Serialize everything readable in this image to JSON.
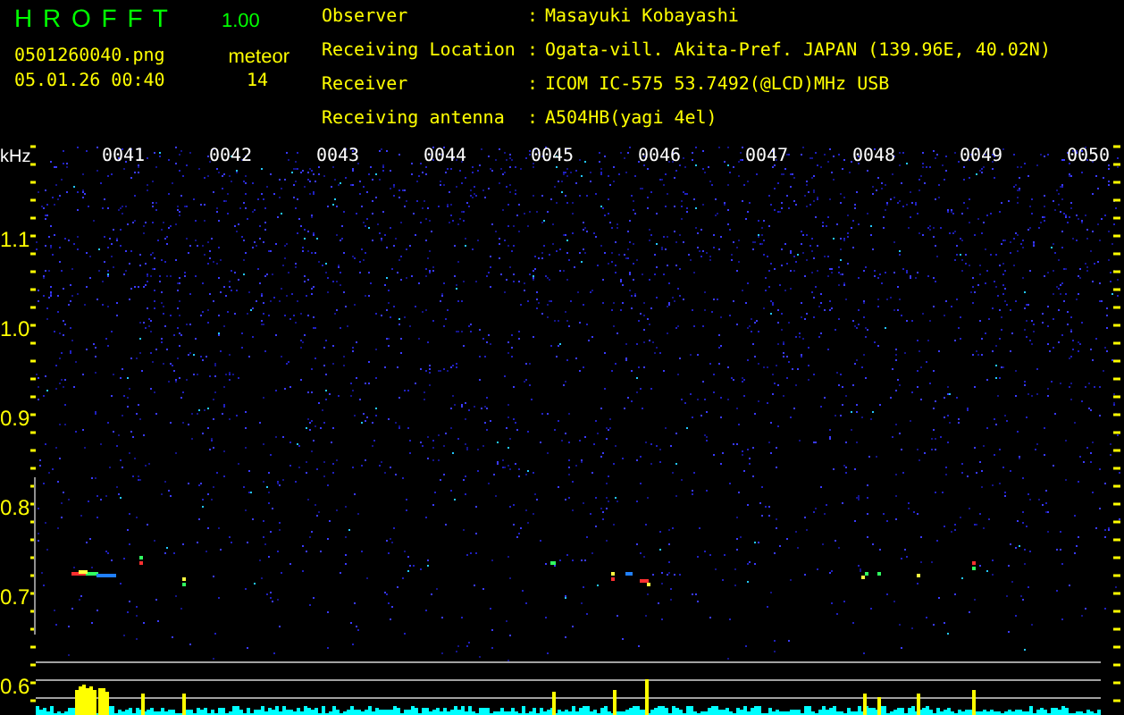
{
  "app": {
    "title": "H R O F F T",
    "version": "1.00"
  },
  "file": "0501260040.png",
  "datetime": "05.01.26 00:40",
  "meteor": {
    "label": "meteor",
    "count": "14"
  },
  "info": [
    {
      "label": "Observer",
      "sep": ":",
      "value": "Masayuki Kobayashi"
    },
    {
      "label": "Receiving Location",
      "sep": ":",
      "value": "Ogata-vill. Akita-Pref. JAPAN (139.96E, 40.02N)"
    },
    {
      "label": "Receiver",
      "sep": ":",
      "value": "ICOM IC-575 53.7492(@LCD)MHz USB"
    },
    {
      "label": "Receiving antenna",
      "sep": ":",
      "value": "A504HB(yagi 4el)"
    }
  ],
  "plot": {
    "y_unit": "kHz",
    "y_labels": [
      "1.1",
      "1.0",
      "0.9",
      "0.8",
      "0.7",
      "0.6"
    ],
    "time_labels": [
      "0041",
      "0042",
      "0043",
      "0044",
      "0045",
      "0046",
      "0047",
      "0048",
      "0049",
      "0050"
    ]
  }
}
